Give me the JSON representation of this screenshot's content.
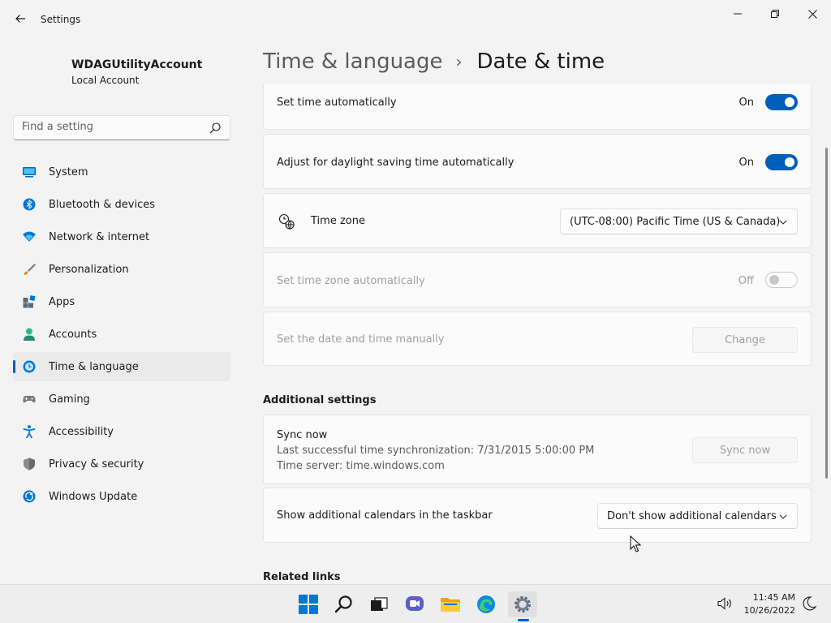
{
  "window": {
    "title": "Settings",
    "back_icon": "back-arrow-icon",
    "controls": [
      "minimize-icon",
      "maximize-icon",
      "close-icon"
    ]
  },
  "profile": {
    "name": "WDAGUtilityAccount",
    "account_type": "Local Account"
  },
  "search": {
    "placeholder": "Find a setting",
    "icon": "search-icon"
  },
  "sidebar": {
    "items": [
      {
        "label": "System",
        "icon": "system-icon",
        "color": "#0067c0"
      },
      {
        "label": "Bluetooth & devices",
        "icon": "bluetooth-icon",
        "color": "#0078d4"
      },
      {
        "label": "Network & internet",
        "icon": "wifi-icon",
        "color": "#0078d4"
      },
      {
        "label": "Personalization",
        "icon": "brush-icon",
        "color": "#e3821e"
      },
      {
        "label": "Apps",
        "icon": "apps-icon",
        "color": "#5b6b7a"
      },
      {
        "label": "Accounts",
        "icon": "person-icon",
        "color": "#2fb68e"
      },
      {
        "label": "Time & language",
        "icon": "globe-clock-icon",
        "color": "#0078d4",
        "active": true
      },
      {
        "label": "Gaming",
        "icon": "gamepad-icon",
        "color": "#6b6b6b"
      },
      {
        "label": "Accessibility",
        "icon": "accessibility-icon",
        "color": "#0078d4"
      },
      {
        "label": "Privacy & security",
        "icon": "shield-icon",
        "color": "#6b6b6b"
      },
      {
        "label": "Windows Update",
        "icon": "update-icon",
        "color": "#0078d4"
      }
    ]
  },
  "header": {
    "parent": "Time & language",
    "separator": "›",
    "current": "Date & time"
  },
  "settings": {
    "set_time_auto": {
      "label": "Set time automatically",
      "state": "On"
    },
    "daylight_saving": {
      "label": "Adjust for daylight saving time automatically",
      "state": "On"
    },
    "time_zone": {
      "label": "Time zone",
      "value": "(UTC-08:00) Pacific Time (US & Canada)",
      "icon": "globe-clock-icon"
    },
    "time_zone_auto": {
      "label": "Set time zone automatically",
      "state": "Off"
    },
    "manual_datetime": {
      "label": "Set the date and time manually",
      "button": "Change"
    }
  },
  "additional": {
    "title": "Additional settings",
    "sync": {
      "label": "Sync now",
      "last_sync": "Last successful time synchronization: 7/31/2015 5:00:00 PM",
      "server": "Time server: time.windows.com",
      "button": "Sync now"
    },
    "calendars": {
      "label": "Show additional calendars in the taskbar",
      "value": "Don't show additional calendars"
    }
  },
  "related": {
    "title": "Related links"
  },
  "taskbar": {
    "apps": [
      "start-icon",
      "search-icon",
      "task-view-icon",
      "chat-icon",
      "file-explorer-icon",
      "edge-icon",
      "settings-icon"
    ],
    "active_app": "settings-icon",
    "time": "11:45 AM",
    "date": "10/26/2022"
  },
  "colors": {
    "accent": "#005fb8",
    "background": "#f3f3f3",
    "card": "#fbfbfb"
  }
}
